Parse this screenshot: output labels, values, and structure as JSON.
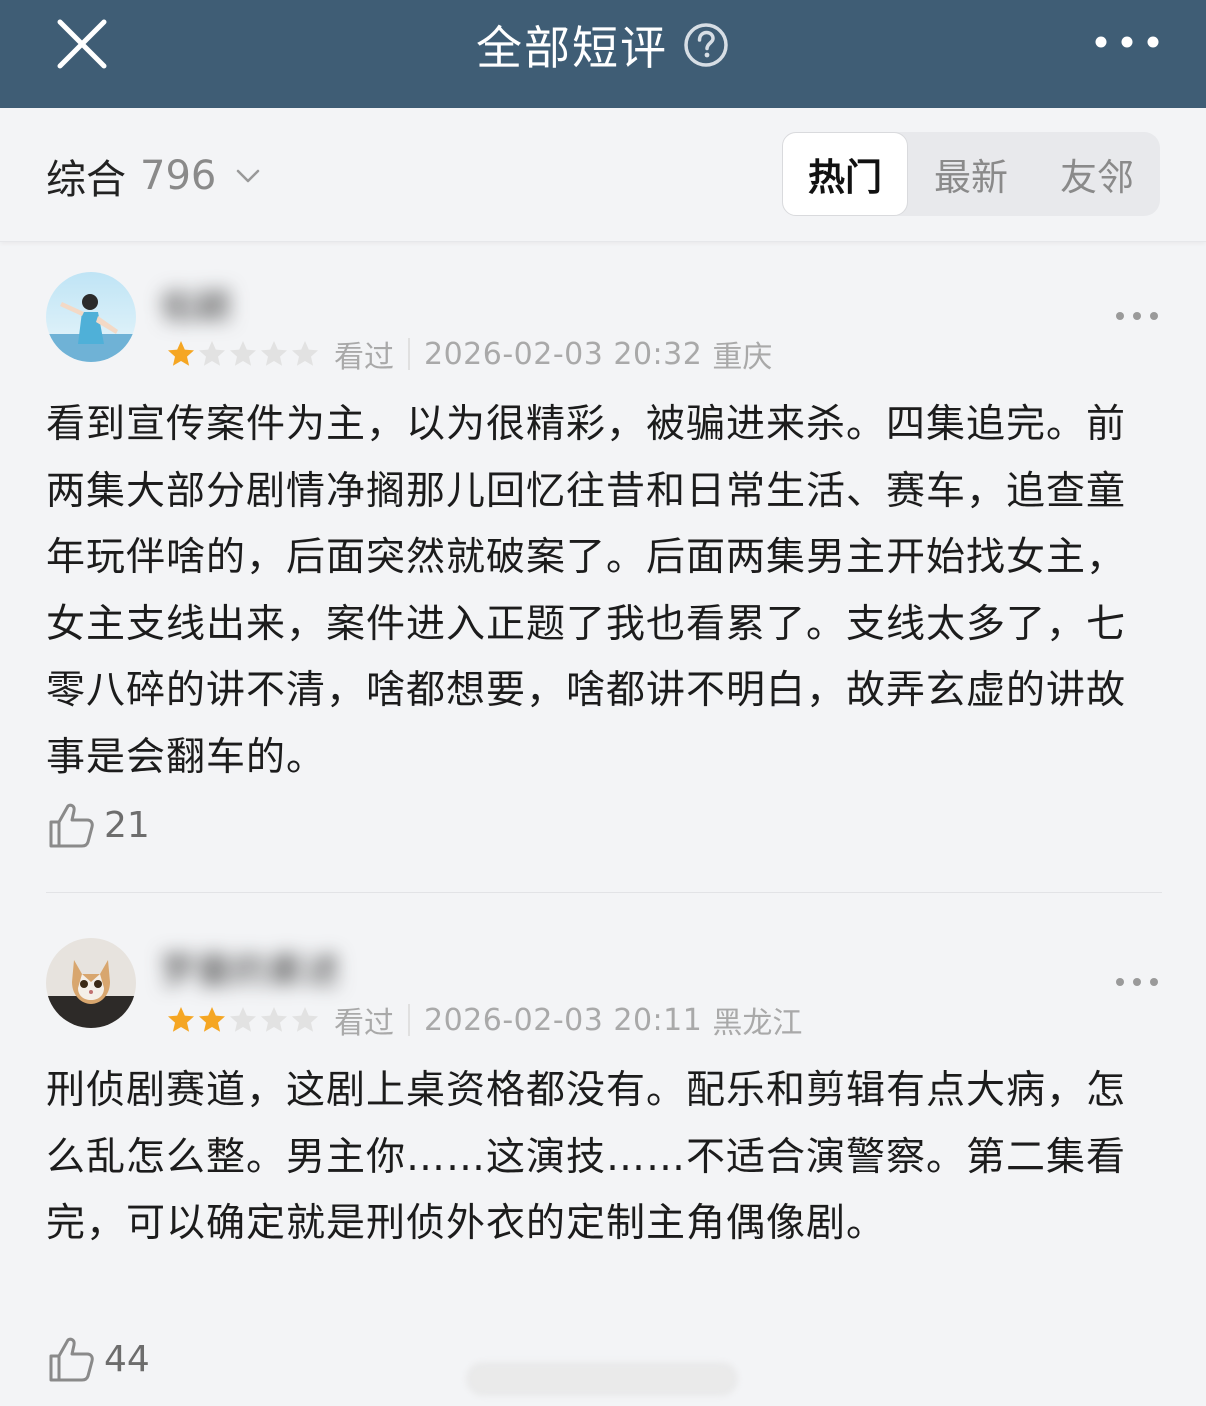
{
  "header": {
    "title": "全部短评"
  },
  "filter": {
    "sort_label": "综合",
    "count": "796",
    "tabs": [
      {
        "label": "热门",
        "active": true
      },
      {
        "label": "最新",
        "active": false
      },
      {
        "label": "友邻",
        "active": false
      }
    ]
  },
  "reviews": [
    {
      "username": "佑颖",
      "rating": 1,
      "status": "看过",
      "datetime": "2026-02-03 20:32",
      "region": "重庆",
      "text": "看到宣传案件为主，以为很精彩，被骗进来杀。四集追完。前两集大部分剧情净搁那儿回忆往昔和日常生活、赛车，追查童年玩伴啥的，后面突然就破案了。后面两集男主开始找女主，女主支线出来，案件进入正题了我也看累了。支线太多了，七零八碎的讲不清，啥都想要，啥都讲不明白，故弄玄虚的讲故事是会翻车的。",
      "likes": "21"
    },
    {
      "username": "罗曼的素述",
      "rating": 2,
      "status": "看过",
      "datetime": "2026-02-03 20:11",
      "region": "黑龙江",
      "text": "刑侦剧赛道，这剧上桌资格都没有。配乐和剪辑有点大病，怎么乱怎么整。男主你……这演技……不适合演警察。第二集看完，可以确定就是刑侦外衣的定制主角偶像剧。",
      "likes": "44"
    }
  ],
  "colors": {
    "header_bg": "#3f5d75",
    "star_filled": "#f5a623",
    "star_empty": "#e2e2e2"
  }
}
